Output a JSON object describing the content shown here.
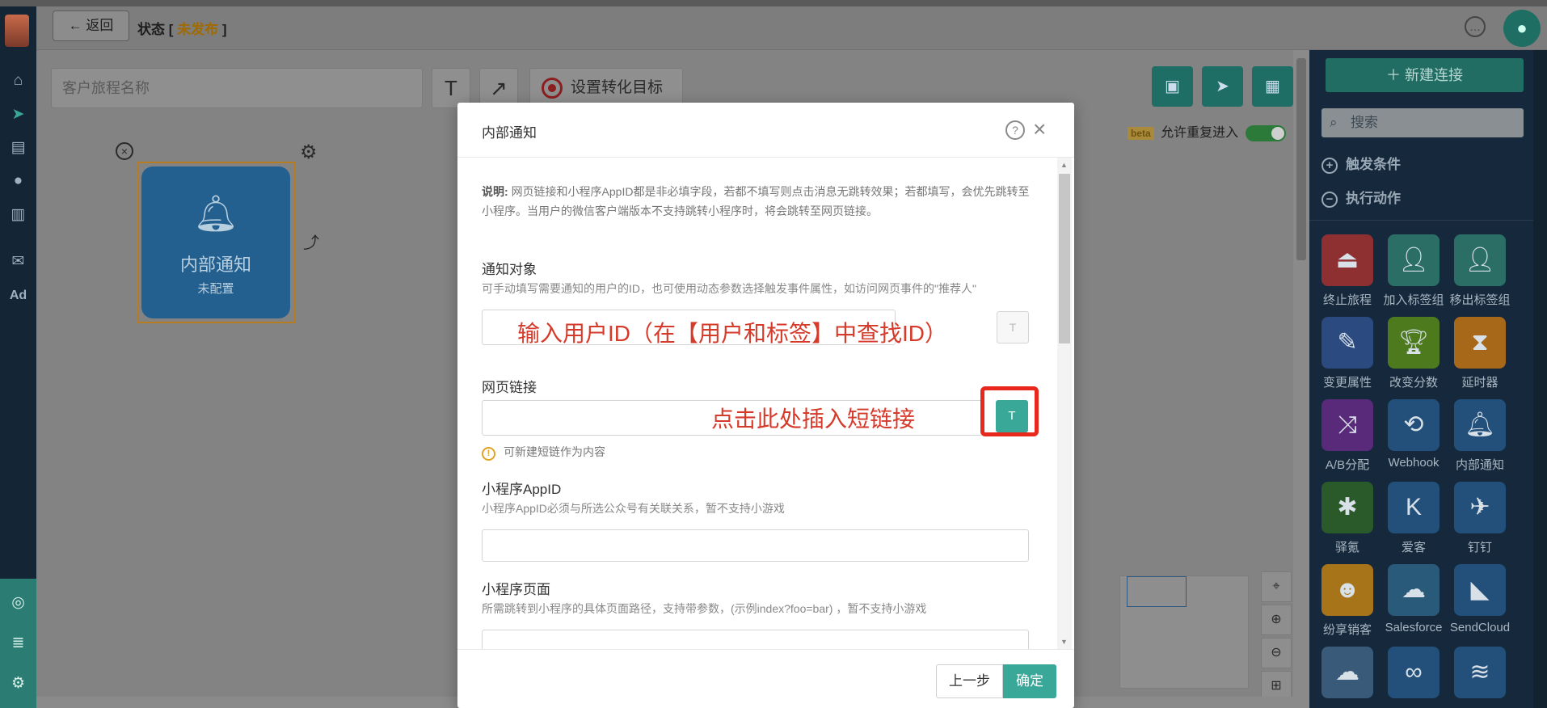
{
  "topbar": {
    "back_label": "返回",
    "status_prefix": "状态 [ ",
    "status_value": "未发布",
    "status_suffix": " ]"
  },
  "canvas": {
    "journey_name_placeholder": "客户旅程名称",
    "text_tool": "T",
    "arrow_tool": "↗",
    "goal_label": "设置转化目标",
    "beta_badge": "beta",
    "allow_reentry_label": "允许重复进入",
    "node": {
      "title": "内部通知",
      "subtitle": "未配置"
    }
  },
  "right_panel": {
    "new_connection_label": "新建连接",
    "search_placeholder": "搜索",
    "sections": {
      "triggers": "触发条件",
      "actions": "执行动作"
    },
    "actions": [
      {
        "label": "终止旅程",
        "icon": "eject-icon",
        "color": "#8e2f31"
      },
      {
        "label": "加入标签组",
        "icon": "user-plus-icon",
        "color": "#2a6e66"
      },
      {
        "label": "移出标签组",
        "icon": "user-minus-icon",
        "color": "#2a6e66"
      },
      {
        "label": "变更属性",
        "icon": "edit-icon",
        "color": "#2a4a80"
      },
      {
        "label": "改变分数",
        "icon": "trophy-icon",
        "color": "#4e7a1e"
      },
      {
        "label": "延时器",
        "icon": "hourglass-icon",
        "color": "#a8681a"
      },
      {
        "label": "A/B分配",
        "icon": "split-icon",
        "color": "#5a2a7a"
      },
      {
        "label": "Webhook",
        "icon": "webhook-icon",
        "color": "#23507a"
      },
      {
        "label": "内部通知",
        "icon": "bell-icon",
        "color": "#23507a"
      },
      {
        "label": "驿氪",
        "icon": "spider-icon",
        "color": "#2a5a2a"
      },
      {
        "label": "爱客",
        "icon": "k-icon",
        "color": "#23507a"
      },
      {
        "label": "钉钉",
        "icon": "dingtalk-icon",
        "color": "#23507a"
      },
      {
        "label": "纷享销客",
        "icon": "fxiaoke-icon",
        "color": "#a8741a"
      },
      {
        "label": "Salesforce",
        "icon": "salesforce-icon",
        "color": "#2a5a7a"
      },
      {
        "label": "SendCloud",
        "icon": "sendcloud-icon",
        "color": "#23507a"
      },
      {
        "label": "",
        "icon": "cloud-icon",
        "color": "#3a5a7a"
      },
      {
        "label": "",
        "icon": "link-cloud-icon",
        "color": "#23507a"
      },
      {
        "label": "",
        "icon": "brand-icon",
        "color": "#23507a"
      }
    ]
  },
  "modal": {
    "title": "内部通知",
    "note_bold": "说明:",
    "note_text": "网页链接和小程序AppID都是非必填字段，若都不填写则点击消息无跳转效果；若都填写，会优先跳转至小程序。当用户的微信客户端版本不支持跳转小程序时，将会跳转至网页链接。",
    "fields": {
      "target_label": "通知对象",
      "target_help": "可手动填写需要通知的用户的ID，也可使用动态参数选择触发事件属性，如访问网页事件的\"推荐人\"",
      "target_annotation": "输入用户ID（在【用户和标签】中查找ID）",
      "url_label": "网页链接",
      "url_annotation": "点击此处插入短链接",
      "url_tip": "可新建短链作为内容",
      "appid_label": "小程序AppID",
      "appid_help": "小程序AppID必须与所选公众号有关联关系，暂不支持小游戏",
      "page_label": "小程序页面",
      "page_help": "所需跳转到小程序的具体页面路径，支持带参数，(示例index?foo=bar) ，暂不支持小游戏"
    },
    "prev_label": "上一步",
    "confirm_label": "确定"
  },
  "colors": {
    "accent": "#3aa899",
    "annotation_red": "#d63a2a",
    "highlight_box": "#e8281c",
    "status_unpublished": "#a06a00"
  }
}
